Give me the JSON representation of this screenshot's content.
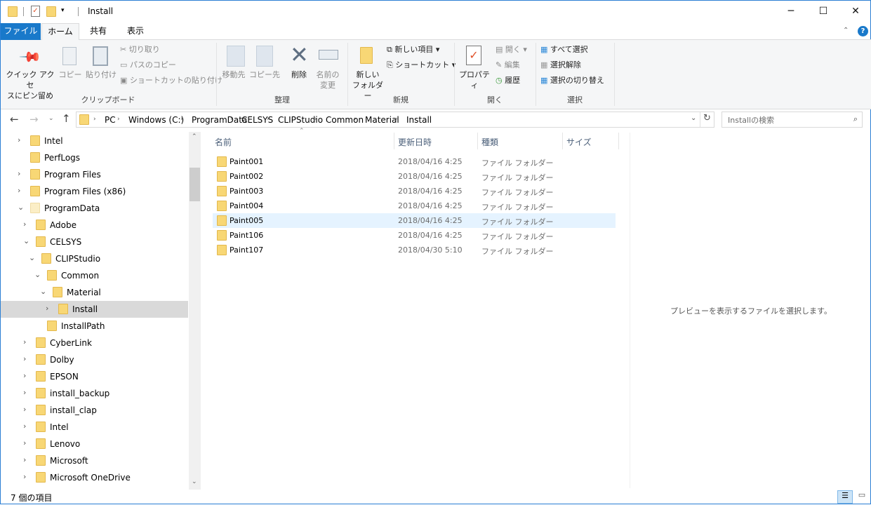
{
  "window": {
    "title": "Install",
    "minimize": "─",
    "maximize": "☐",
    "close": "✕"
  },
  "tabs": [
    {
      "label": "ファイル"
    },
    {
      "label": "ホーム"
    },
    {
      "label": "共有"
    },
    {
      "label": "表示"
    }
  ],
  "ribbon": {
    "clipboard": {
      "pin": "クイック アクセ",
      "pin2": "スにピン留め",
      "copy": "コピー",
      "paste": "貼り付け",
      "cut": "切り取り",
      "copy_path": "パスのコピー",
      "paste_shortcut": "ショートカットの貼り付け",
      "group": "クリップボード"
    },
    "organize": {
      "move_to": "移動先",
      "copy_to": "コピー先",
      "delete": "削除",
      "rename": "名前の",
      "rename2": "変更",
      "group": "整理"
    },
    "new": {
      "new_folder": "新しい",
      "new_folder2": "フォルダー",
      "new_item": "新しい項目 ▾",
      "shortcut": "ショートカット ▾",
      "group": "新規"
    },
    "open": {
      "properties": "プロパティ",
      "open": "開く ▾",
      "edit": "編集",
      "history": "履歴",
      "group": "開く"
    },
    "select": {
      "select_all": "すべて選択",
      "select_none": "選択解除",
      "invert": "選択の切り替え",
      "group": "選択"
    }
  },
  "address": {
    "crumbs": [
      "PC",
      "Windows (C:)",
      "ProgramData",
      "CELSYS",
      "CLIPStudio",
      "Common",
      "Material",
      "Install"
    ],
    "search_placeholder": "Installの検索"
  },
  "nav": [
    {
      "label": "Intel",
      "level": 0,
      "arrow": "›"
    },
    {
      "label": "PerfLogs",
      "level": 0,
      "arrow": ""
    },
    {
      "label": "Program Files",
      "level": 0,
      "arrow": "›"
    },
    {
      "label": "Program Files (x86)",
      "level": 0,
      "arrow": "›"
    },
    {
      "label": "ProgramData",
      "level": 0,
      "arrow": "⌄",
      "pale": true
    },
    {
      "label": "Adobe",
      "level": 1,
      "arrow": "›"
    },
    {
      "label": "CELSYS",
      "level": 1,
      "arrow": "⌄"
    },
    {
      "label": "CLIPStudio",
      "level": 2,
      "arrow": "⌄"
    },
    {
      "label": "Common",
      "level": 3,
      "arrow": "⌄"
    },
    {
      "label": "Material",
      "level": 4,
      "arrow": "⌄"
    },
    {
      "label": "Install",
      "level": 5,
      "arrow": "›",
      "selected": true
    },
    {
      "label": "InstallPath",
      "level": 3,
      "arrow": ""
    },
    {
      "label": "CyberLink",
      "level": 1,
      "arrow": "›"
    },
    {
      "label": "Dolby",
      "level": 1,
      "arrow": "›"
    },
    {
      "label": "EPSON",
      "level": 1,
      "arrow": "›"
    },
    {
      "label": "install_backup",
      "level": 1,
      "arrow": "›"
    },
    {
      "label": "install_clap",
      "level": 1,
      "arrow": "›"
    },
    {
      "label": "Intel",
      "level": 1,
      "arrow": "›"
    },
    {
      "label": "Lenovo",
      "level": 1,
      "arrow": "›"
    },
    {
      "label": "Microsoft",
      "level": 1,
      "arrow": "›"
    },
    {
      "label": "Microsoft OneDrive",
      "level": 1,
      "arrow": "›"
    }
  ],
  "columns": {
    "name": "名前",
    "date": "更新日時",
    "type": "種類",
    "size": "サイズ"
  },
  "files": [
    {
      "name": "Paint001",
      "date": "2018/04/16 4:25",
      "type": "ファイル フォルダー"
    },
    {
      "name": "Paint002",
      "date": "2018/04/16 4:25",
      "type": "ファイル フォルダー"
    },
    {
      "name": "Paint003",
      "date": "2018/04/16 4:25",
      "type": "ファイル フォルダー"
    },
    {
      "name": "Paint004",
      "date": "2018/04/16 4:25",
      "type": "ファイル フォルダー"
    },
    {
      "name": "Paint005",
      "date": "2018/04/16 4:25",
      "type": "ファイル フォルダー",
      "hover": true
    },
    {
      "name": "Paint106",
      "date": "2018/04/16 4:25",
      "type": "ファイル フォルダー"
    },
    {
      "name": "Paint107",
      "date": "2018/04/30 5:10",
      "type": "ファイル フォルダー"
    }
  ],
  "preview": {
    "message": "プレビューを表示するファイルを選択します。"
  },
  "status": {
    "count": "7 個の項目"
  }
}
